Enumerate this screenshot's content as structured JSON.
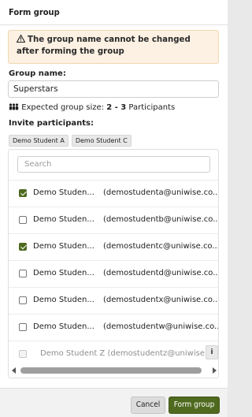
{
  "dialog": {
    "title": "Form group"
  },
  "warning": {
    "text": "The group name cannot be changed after forming the group"
  },
  "group_name": {
    "label": "Group name:",
    "value": "Superstars"
  },
  "group_size": {
    "prefix": "Expected group size:",
    "range": "2 - 3",
    "suffix": "Participants"
  },
  "invite": {
    "label": "Invite participants:",
    "selected": [
      "Demo Student A",
      "Demo Student C"
    ]
  },
  "search": {
    "placeholder": "Search"
  },
  "participants": [
    {
      "name": "Demo Studen...",
      "email": "(demostudenta@uniwise.co....",
      "checked": true
    },
    {
      "name": "Demo Studen...",
      "email": "(demostudentb@uniwise.co....",
      "checked": false
    },
    {
      "name": "Demo Studen...",
      "email": "(demostudentc@uniwise.co....",
      "checked": true
    },
    {
      "name": "Demo Studen...",
      "email": "(demostudentd@uniwise.co....",
      "checked": false
    },
    {
      "name": "Demo Studen...",
      "email": "(demostudentx@uniwise.co....",
      "checked": false
    },
    {
      "name": "Demo Studen...",
      "email": "(demostudentw@uniwise.co....",
      "checked": false
    }
  ],
  "disabled_participant": {
    "text": "Demo Student Z (demostudentz@uniwise.co",
    "info": "i"
  },
  "footer": {
    "cancel": "Cancel",
    "form": "Form group"
  },
  "colors": {
    "primary": "#4f6a1f",
    "warning_bg": "#fcf1e3"
  }
}
